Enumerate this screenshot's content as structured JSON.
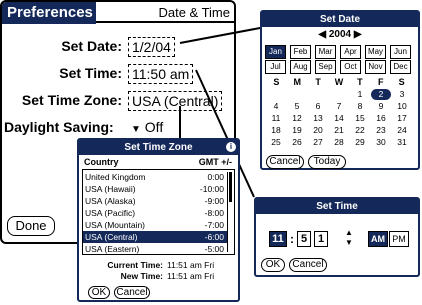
{
  "preferences": {
    "title": "Preferences",
    "tab": "Date & Time",
    "set_date_label": "Set Date:",
    "set_date_value": "1/2/04",
    "set_time_label": "Set Time:",
    "set_time_value": "11:50 am",
    "set_time_zone_label": "Set Time Zone:",
    "set_time_zone_value": "USA (Central)",
    "daylight_saving_label": "Daylight Saving:",
    "daylight_saving_value": "Off",
    "done_label": "Done"
  },
  "set_date": {
    "title": "Set Date",
    "year": "2004",
    "months": [
      "Jan",
      "Feb",
      "Mar",
      "Apr",
      "May",
      "Jun",
      "Jul",
      "Aug",
      "Sep",
      "Oct",
      "Nov",
      "Dec"
    ],
    "selected_month": "Jan",
    "weekdays": [
      "S",
      "M",
      "T",
      "W",
      "T",
      "F",
      "S"
    ],
    "weeks": [
      [
        "",
        "",
        "",
        "",
        "1",
        "2",
        "3"
      ],
      [
        "4",
        "5",
        "6",
        "7",
        "8",
        "9",
        "10"
      ],
      [
        "11",
        "12",
        "13",
        "14",
        "15",
        "16",
        "17"
      ],
      [
        "18",
        "19",
        "20",
        "21",
        "22",
        "23",
        "24"
      ],
      [
        "25",
        "26",
        "27",
        "28",
        "29",
        "30",
        "31"
      ]
    ],
    "selected_day": "2",
    "cancel_label": "Cancel",
    "today_label": "Today"
  },
  "set_time_zone": {
    "title": "Set Time Zone",
    "col_country": "Country",
    "col_gmt": "GMT +/-",
    "rows": [
      {
        "name": "United Kingdom",
        "offset": "0:00"
      },
      {
        "name": "USA (Hawaii)",
        "offset": "-10:00"
      },
      {
        "name": "USA (Alaska)",
        "offset": "-9:00"
      },
      {
        "name": "USA (Pacific)",
        "offset": "-8:00"
      },
      {
        "name": "USA (Mountain)",
        "offset": "-7:00"
      },
      {
        "name": "USA (Central)",
        "offset": "-6:00"
      },
      {
        "name": "USA (Eastern)",
        "offset": "-5:00"
      }
    ],
    "selected_row": "USA (Central)",
    "current_time_label": "Current Time:",
    "current_time_value": "11:51 am Fri",
    "new_time_label": "New Time:",
    "new_time_value": "11:51 am Fri",
    "ok_label": "OK",
    "cancel_label": "Cancel"
  },
  "set_time": {
    "title": "Set Time",
    "hour": "11",
    "minute_tens": "5",
    "minute_ones": "1",
    "separator": ":",
    "am_label": "AM",
    "pm_label": "PM",
    "selected_period": "AM",
    "ok_label": "OK",
    "cancel_label": "Cancel"
  },
  "colors": {
    "accent": "#14295a",
    "background": "#ffffff"
  }
}
